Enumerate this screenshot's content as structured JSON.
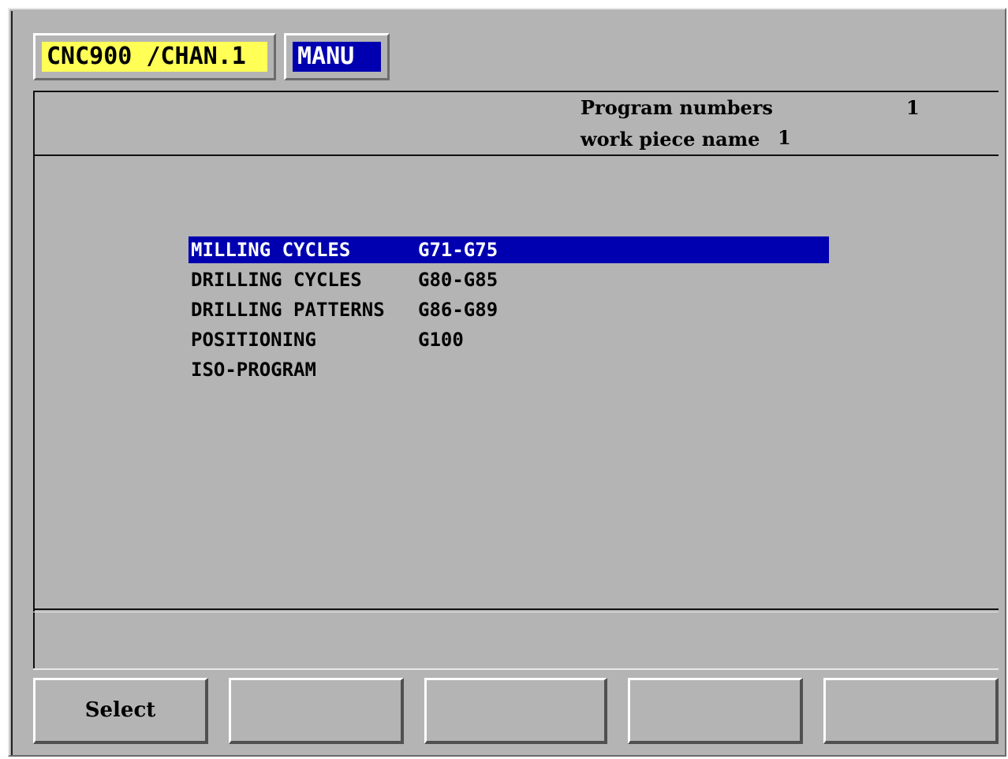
{
  "header": {
    "channel": "CNC900 /CHAN.1",
    "mode": "MANU"
  },
  "info": {
    "program_numbers_label": "Program numbers",
    "program_numbers_value": "1",
    "work_piece_label": "work piece name",
    "work_piece_value": "1"
  },
  "menu": {
    "items": [
      {
        "name": "MILLING CYCLES",
        "code": "G71-G75",
        "selected": true
      },
      {
        "name": "DRILLING CYCLES",
        "code": "G80-G85",
        "selected": false
      },
      {
        "name": "DRILLING PATTERNS",
        "code": "G86-G89",
        "selected": false
      },
      {
        "name": "POSITIONING",
        "code": "G100",
        "selected": false
      },
      {
        "name": "ISO-PROGRAM",
        "code": "",
        "selected": false
      }
    ]
  },
  "softkeys": [
    "Select",
    "",
    "",
    "",
    ""
  ],
  "colors": {
    "background": "#b4b4b4",
    "highlight": "#0000b0",
    "channel_box": "#ffff55"
  }
}
